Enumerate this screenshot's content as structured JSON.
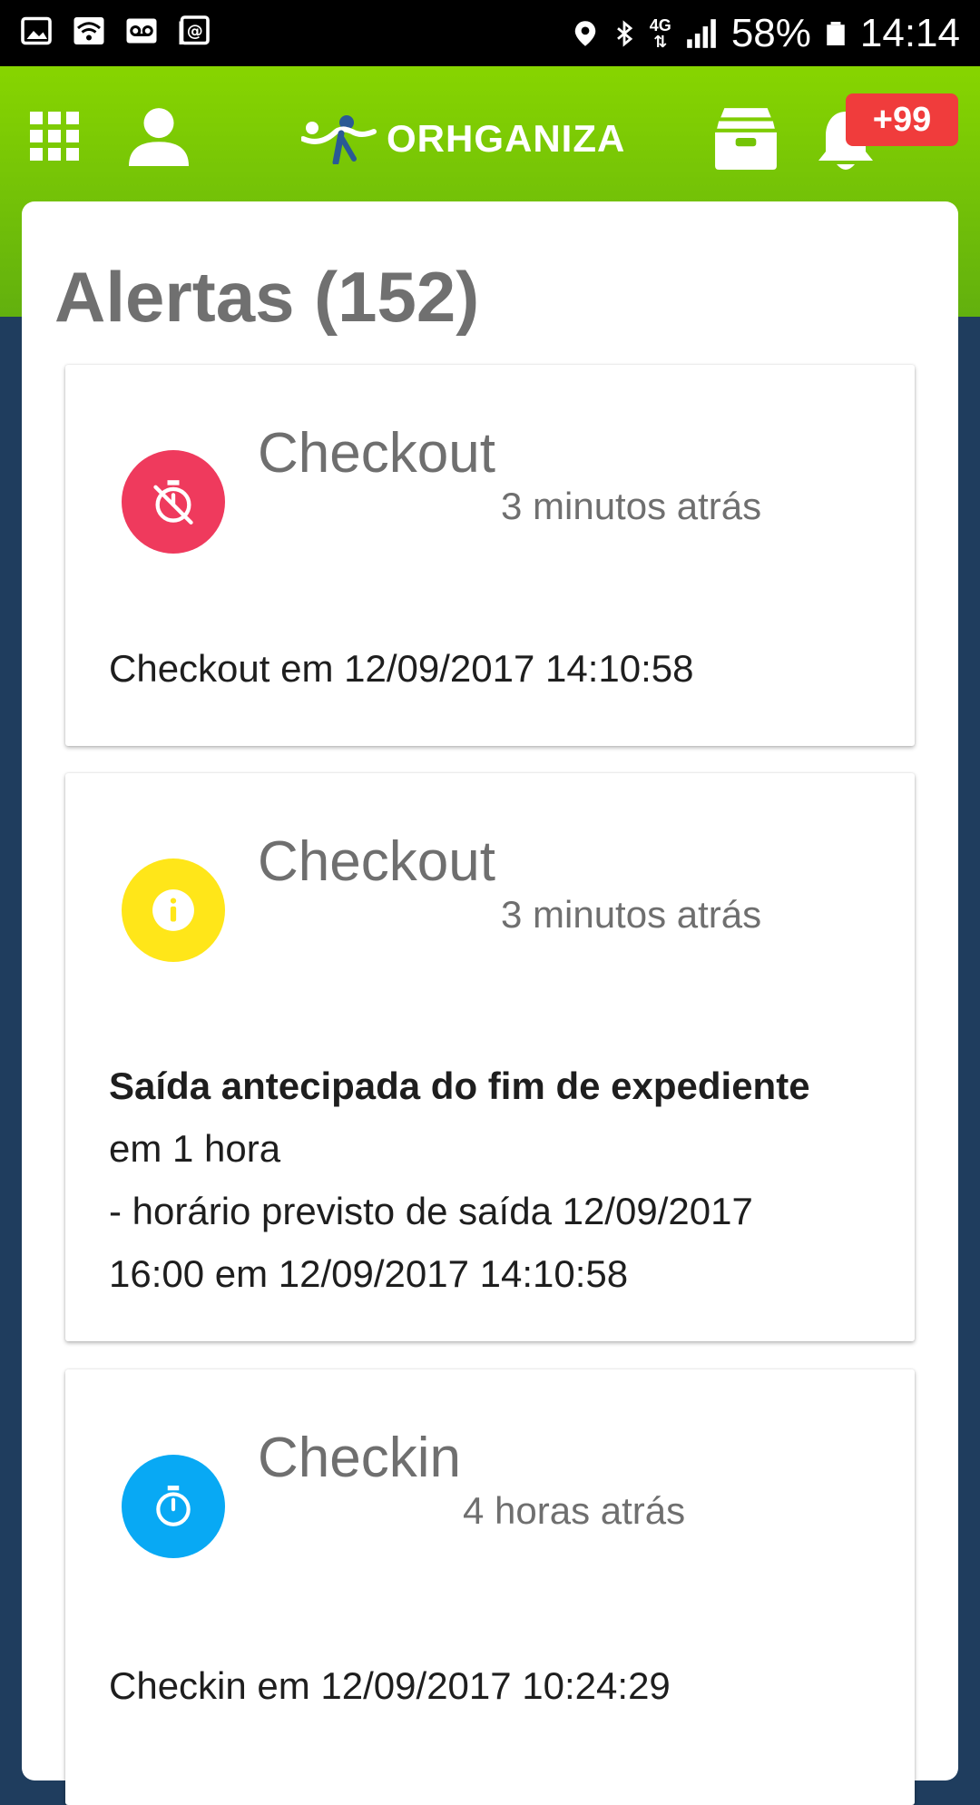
{
  "status_bar": {
    "battery": "58%",
    "time": "14:14",
    "network": "4G"
  },
  "header": {
    "logo_text": "ORHGANIZA",
    "notification_badge": "+99",
    "colors": {
      "bar_top": "#87d500",
      "bar_bottom": "#62b00e",
      "badge": "#f03c3c"
    }
  },
  "page": {
    "title": "Alertas (152)"
  },
  "alerts": [
    {
      "title": "Checkout",
      "time": "3 minutos atrás",
      "icon": "timer-off-icon",
      "icon_color": "#ef3a5d",
      "body_bold": "",
      "body_lines": [
        "Checkout em 12/09/2017 14:10:58"
      ]
    },
    {
      "title": "Checkout",
      "time": "3 minutos atrás",
      "icon": "info-icon",
      "icon_color": "#ffe619",
      "body_bold": "Saída antecipada do fim de expediente",
      "body_lines": [
        "em 1 hora",
        "- horário previsto de saída 12/09/2017",
        "16:00 em 12/09/2017 14:10:58"
      ]
    },
    {
      "title": "Checkin",
      "time": "4 horas atrás",
      "icon": "timer-icon",
      "icon_color": "#08a9f4",
      "body_bold": "",
      "body_lines": [
        "Checkin em 12/09/2017 10:24:29"
      ]
    }
  ]
}
